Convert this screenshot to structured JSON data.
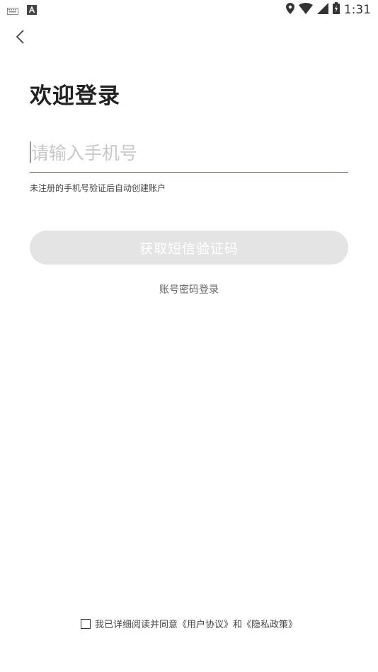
{
  "status_bar": {
    "time": "1:31",
    "icons": [
      "keyboard-icon",
      "a-badge-icon",
      "location-icon",
      "wifi-icon",
      "signal-icon",
      "battery-icon"
    ]
  },
  "header": {
    "back_icon": "chevron-left-icon"
  },
  "main": {
    "title": "欢迎登录",
    "phone_placeholder": "请输入手机号",
    "phone_value": "",
    "hint": "未注册的手机号验证后自动创建账户",
    "sms_button_label": "获取短信验证码",
    "password_login_label": "账号密码登录"
  },
  "agreement": {
    "prefix": "我已详细阅读并同意",
    "user_agreement": "《用户协议》",
    "conjunction": "和",
    "privacy_policy": "《隐私政策》",
    "checked": false
  },
  "colors": {
    "accent": "#e0305a",
    "button_disabled_bg": "#e4e4e4",
    "placeholder": "#c8c8c8"
  }
}
